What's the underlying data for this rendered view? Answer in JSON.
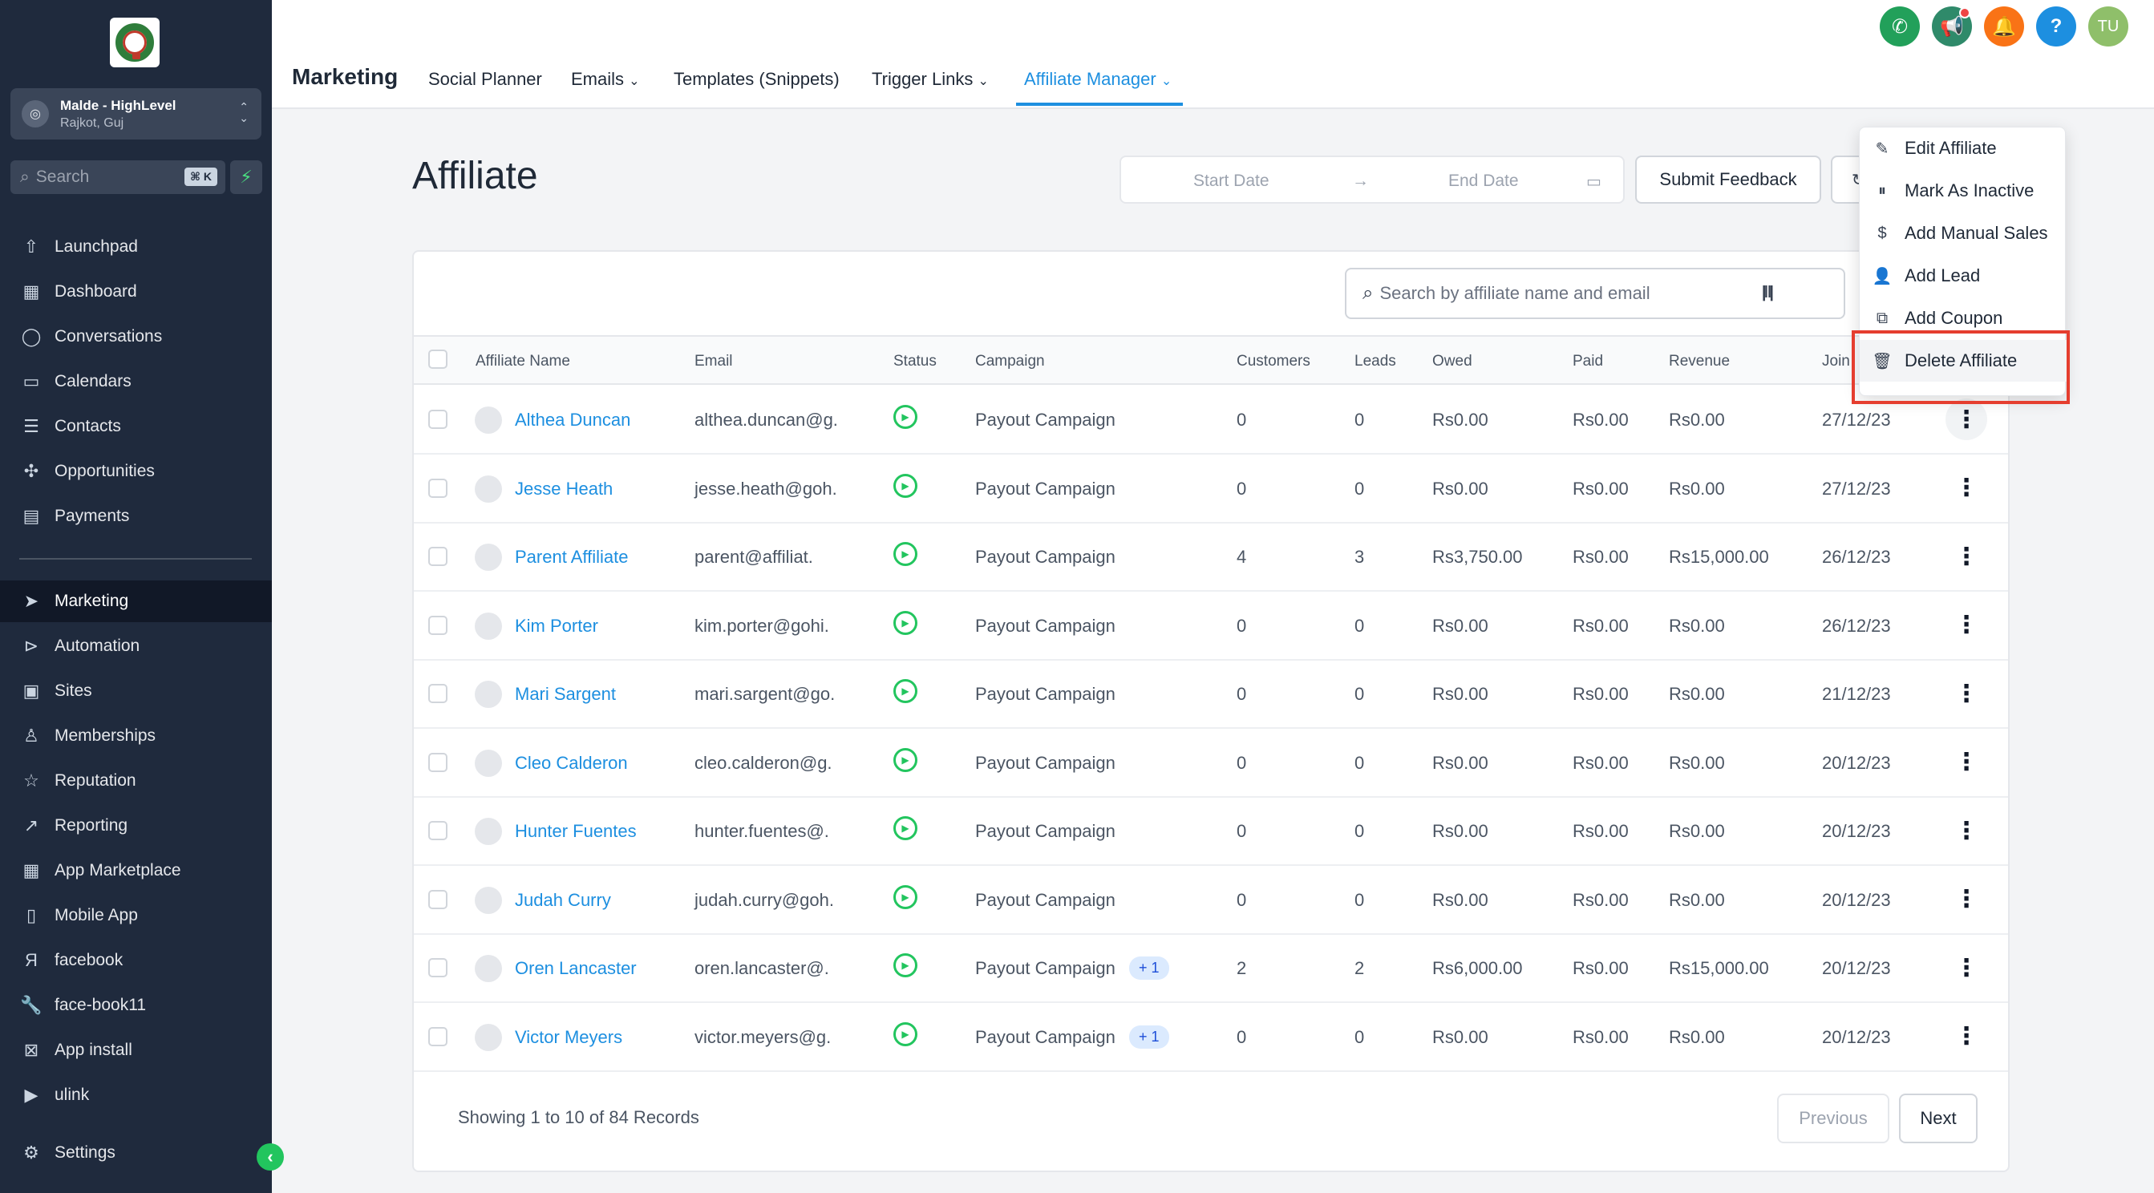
{
  "sidebar": {
    "account": {
      "name": "Malde - HighLevel",
      "location": "Rajkot, Guj"
    },
    "search": {
      "placeholder": "Search",
      "shortcut": "⌘ K"
    },
    "items": [
      {
        "label": "Launchpad",
        "icon": "rocket-icon"
      },
      {
        "label": "Dashboard",
        "icon": "grid-icon"
      },
      {
        "label": "Conversations",
        "icon": "chat-icon"
      },
      {
        "label": "Calendars",
        "icon": "calendar-icon"
      },
      {
        "label": "Contacts",
        "icon": "contacts-icon"
      },
      {
        "label": "Opportunities",
        "icon": "network-icon"
      },
      {
        "label": "Payments",
        "icon": "receipt-icon"
      },
      {
        "label": "Marketing",
        "icon": "send-icon",
        "active": true
      },
      {
        "label": "Automation",
        "icon": "automation-icon"
      },
      {
        "label": "Sites",
        "icon": "sites-icon"
      },
      {
        "label": "Memberships",
        "icon": "membership-icon"
      },
      {
        "label": "Reputation",
        "icon": "star-icon"
      },
      {
        "label": "Reporting",
        "icon": "trend-icon"
      },
      {
        "label": "App Marketplace",
        "icon": "grid-icon"
      },
      {
        "label": "Mobile App",
        "icon": "mobile-icon"
      },
      {
        "label": "facebook",
        "icon": "letter-icon"
      },
      {
        "label": "face-book11",
        "icon": "wrench-icon"
      },
      {
        "label": "App install",
        "icon": "x-box-icon"
      },
      {
        "label": "ulink",
        "icon": "youtube-icon"
      }
    ],
    "settings_label": "Settings"
  },
  "header": {
    "title": "Marketing",
    "tabs": [
      {
        "label": "Social Planner",
        "dropdown": false
      },
      {
        "label": "Emails",
        "dropdown": true
      },
      {
        "label": "Templates (Snippets)",
        "dropdown": false
      },
      {
        "label": "Trigger Links",
        "dropdown": true
      },
      {
        "label": "Affiliate Manager",
        "dropdown": true,
        "active": true
      }
    ],
    "user_initials": "TU",
    "colors": {
      "phone": "#22a05a",
      "megaphone": "#2f8a6a",
      "bell": "#f97316",
      "help": "#1d8fe0",
      "avatar": "#8fbf6a",
      "accent": "#1d8fe0"
    }
  },
  "page": {
    "title": "Affiliate",
    "start_date_placeholder": "Start Date",
    "end_date_placeholder": "End Date",
    "submit_feedback_label": "Submit Feedback",
    "search_placeholder": "Search by affiliate name and email"
  },
  "table": {
    "columns": [
      "Affiliate Name",
      "Email",
      "Status",
      "Campaign",
      "Customers",
      "Leads",
      "Owed",
      "Paid",
      "Revenue",
      "Join"
    ],
    "rows": [
      {
        "name": "Althea Duncan",
        "email": "althea.duncan@g.",
        "campaign": "Payout Campaign",
        "extra": "",
        "customers": "0",
        "leads": "0",
        "owed": "Rs0.00",
        "paid": "Rs0.00",
        "revenue": "Rs0.00",
        "joined": "27/12/23"
      },
      {
        "name": "Jesse Heath",
        "email": "jesse.heath@goh.",
        "campaign": "Payout Campaign",
        "extra": "",
        "customers": "0",
        "leads": "0",
        "owed": "Rs0.00",
        "paid": "Rs0.00",
        "revenue": "Rs0.00",
        "joined": "27/12/23"
      },
      {
        "name": "Parent Affiliate",
        "email": "parent@affiliat.",
        "campaign": "Payout Campaign",
        "extra": "",
        "customers": "4",
        "leads": "3",
        "owed": "Rs3,750.00",
        "paid": "Rs0.00",
        "revenue": "Rs15,000.00",
        "joined": "26/12/23"
      },
      {
        "name": "Kim Porter",
        "email": "kim.porter@gohi.",
        "campaign": "Payout Campaign",
        "extra": "",
        "customers": "0",
        "leads": "0",
        "owed": "Rs0.00",
        "paid": "Rs0.00",
        "revenue": "Rs0.00",
        "joined": "26/12/23"
      },
      {
        "name": "Mari Sargent",
        "email": "mari.sargent@go.",
        "campaign": "Payout Campaign",
        "extra": "",
        "customers": "0",
        "leads": "0",
        "owed": "Rs0.00",
        "paid": "Rs0.00",
        "revenue": "Rs0.00",
        "joined": "21/12/23"
      },
      {
        "name": "Cleo Calderon",
        "email": "cleo.calderon@g.",
        "campaign": "Payout Campaign",
        "extra": "",
        "customers": "0",
        "leads": "0",
        "owed": "Rs0.00",
        "paid": "Rs0.00",
        "revenue": "Rs0.00",
        "joined": "20/12/23"
      },
      {
        "name": "Hunter Fuentes",
        "email": "hunter.fuentes@.",
        "campaign": "Payout Campaign",
        "extra": "",
        "customers": "0",
        "leads": "0",
        "owed": "Rs0.00",
        "paid": "Rs0.00",
        "revenue": "Rs0.00",
        "joined": "20/12/23"
      },
      {
        "name": "Judah Curry",
        "email": "judah.curry@goh.",
        "campaign": "Payout Campaign",
        "extra": "",
        "customers": "0",
        "leads": "0",
        "owed": "Rs0.00",
        "paid": "Rs0.00",
        "revenue": "Rs0.00",
        "joined": "20/12/23"
      },
      {
        "name": "Oren Lancaster",
        "email": "oren.lancaster@.",
        "campaign": "Payout Campaign",
        "extra": "+ 1",
        "customers": "2",
        "leads": "2",
        "owed": "Rs6,000.00",
        "paid": "Rs0.00",
        "revenue": "Rs15,000.00",
        "joined": "20/12/23"
      },
      {
        "name": "Victor Meyers",
        "email": "victor.meyers@g.",
        "campaign": "Payout Campaign",
        "extra": "+ 1",
        "customers": "0",
        "leads": "0",
        "owed": "Rs0.00",
        "paid": "Rs0.00",
        "revenue": "Rs0.00",
        "joined": "20/12/23"
      }
    ]
  },
  "footer": {
    "records_text": "Showing 1 to 10 of 84 Records",
    "previous_label": "Previous",
    "next_label": "Next"
  },
  "row_menu": {
    "items": [
      {
        "label": "Edit Affiliate",
        "icon": "pencil-icon"
      },
      {
        "label": "Mark As Inactive",
        "icon": "pause-icon"
      },
      {
        "label": "Add Manual Sales",
        "icon": "dollar-icon"
      },
      {
        "label": "Add Lead",
        "icon": "user-plus-icon"
      },
      {
        "label": "Add Coupon",
        "icon": "coupon-icon"
      },
      {
        "label": "Delete Affiliate",
        "icon": "trash-icon",
        "highlighted": true
      }
    ],
    "highlight_color": "#e53e2f"
  }
}
